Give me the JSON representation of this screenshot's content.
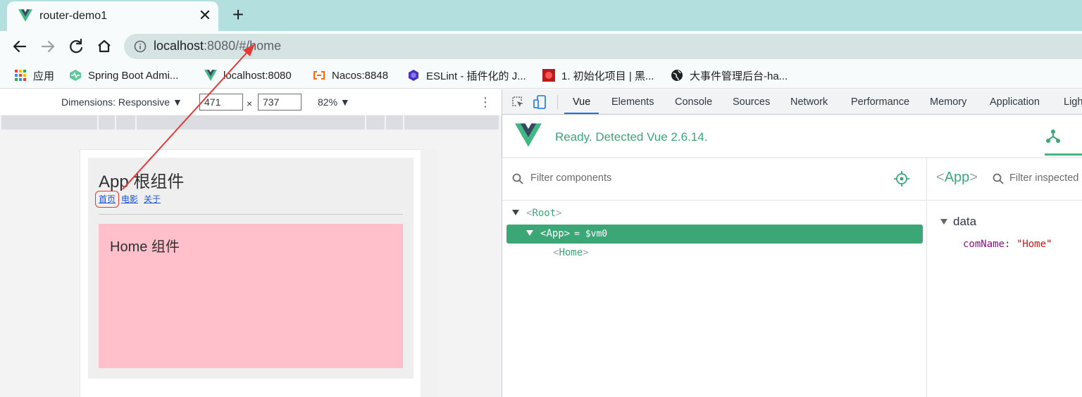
{
  "browser": {
    "tab_title": "router-demo1",
    "close_glyph": "✕",
    "newtab_glyph": "+",
    "url_host": "localhost",
    "url_rest": ":8080/#/home"
  },
  "bookmarks": [
    {
      "label": "应用",
      "icon": "apps-grid-icon"
    },
    {
      "label": "Spring Boot Admi...",
      "icon": "spring-boot-admin-icon"
    },
    {
      "label": "localhost:8080",
      "icon": "vue-logo-icon"
    },
    {
      "label": "Nacos:8848",
      "icon": "nacos-icon"
    },
    {
      "label": "ESLint - 插件化的 J...",
      "icon": "eslint-icon"
    },
    {
      "label": "1. 初始化项目 | 黑...",
      "icon": "red-site-icon"
    },
    {
      "label": "大事件管理后台-ha...",
      "icon": "globe-icon"
    }
  ],
  "device_toolbar": {
    "dimensions_label": "Dimensions: Responsive ▼",
    "width": "471",
    "times": "×",
    "height": "737",
    "zoom": "82% ▼",
    "more_glyph": "⋮"
  },
  "app": {
    "title": "App 根组件",
    "links": [
      "首页",
      "电影",
      "关于"
    ],
    "home_title": "Home 组件"
  },
  "devtools": {
    "tabs": [
      "Vue",
      "Elements",
      "Console",
      "Sources",
      "Network",
      "Performance",
      "Memory",
      "Application",
      "Lighthouse"
    ],
    "active_tab": "Vue",
    "vue_status": "Ready. Detected Vue 2.6.14.",
    "filter_components_placeholder": "Filter components",
    "filter_inspected_placeholder": "Filter inspected data",
    "tree": {
      "lt": "<",
      "gt": ">",
      "root": "Root",
      "app": "App",
      "vm": "= $vm0",
      "home": "Home"
    },
    "inspector": {
      "component": "App",
      "section": "data",
      "prop_key": "comName",
      "prop_colon": ":",
      "prop_value": "\"Home\""
    }
  },
  "colors": {
    "vue_green": "#3ba776",
    "tab_strip": "#b4dfdf",
    "home_bg": "#ffc0cb",
    "annotation_red": "#e53935"
  }
}
